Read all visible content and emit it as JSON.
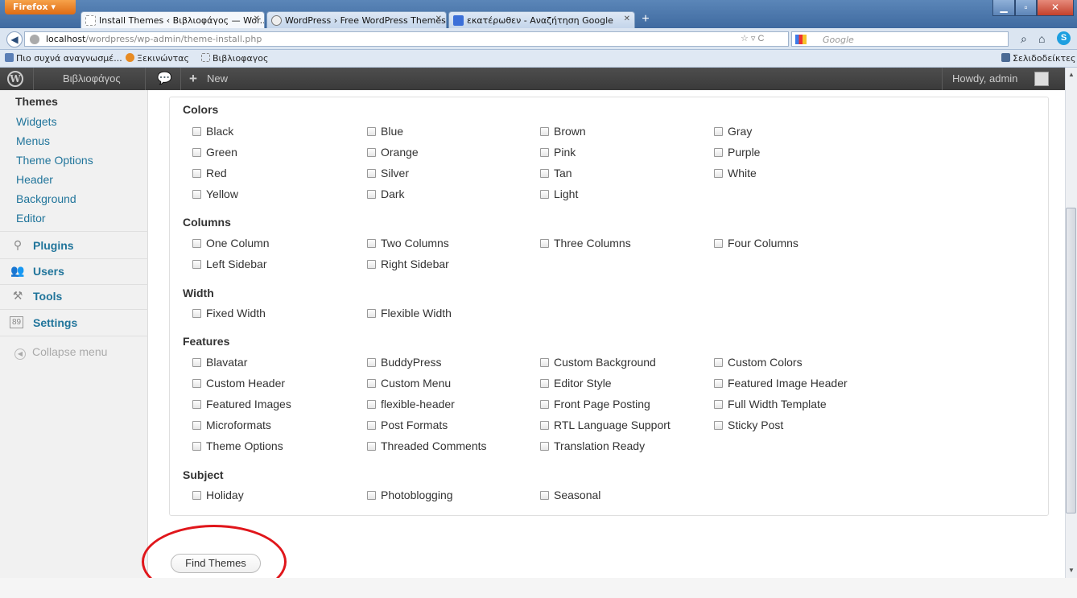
{
  "browser": {
    "menu_button": "Firefox ▾",
    "tabs": [
      {
        "title": "Install Themes ‹ Βιβλιοφάγος — Wor...",
        "icon": "page-icon",
        "active": true
      },
      {
        "title": "WordPress › Free WordPress Themes",
        "icon": "wordpress-icon",
        "active": false
      },
      {
        "title": "εκατέρωθεν - Αναζήτηση Google",
        "icon": "google-icon",
        "active": false
      }
    ],
    "url_host": "localhost",
    "url_path": "/wordpress/wp-admin/theme-install.php",
    "search_placeholder": "Google",
    "bookmarks": [
      "Πιο συχνά αναγνωσμέ...",
      "Ξεκινώντας",
      "Βιβλιοφαγος"
    ],
    "bookmarks_menu": "Σελιδοδείκτες"
  },
  "adminbar": {
    "site_name": "Βιβλιοφάγος",
    "new_label": "New",
    "greeting": "Howdy, admin"
  },
  "sidebar": {
    "appearance_submenu": [
      "Themes",
      "Widgets",
      "Menus",
      "Theme Options",
      "Header",
      "Background",
      "Editor"
    ],
    "menu": [
      {
        "label": "Plugins",
        "icon": "plugin-icon"
      },
      {
        "label": "Users",
        "icon": "users-icon"
      },
      {
        "label": "Tools",
        "icon": "tools-icon"
      },
      {
        "label": "Settings",
        "icon": "settings-icon"
      }
    ],
    "collapse": "Collapse menu"
  },
  "filters": {
    "colors": {
      "heading": "Colors",
      "options": [
        "Black",
        "Blue",
        "Brown",
        "Gray",
        "Green",
        "Orange",
        "Pink",
        "Purple",
        "Red",
        "Silver",
        "Tan",
        "White",
        "Yellow",
        "Dark",
        "Light"
      ]
    },
    "columns": {
      "heading": "Columns",
      "options": [
        "One Column",
        "Two Columns",
        "Three Columns",
        "Four Columns",
        "Left Sidebar",
        "Right Sidebar"
      ]
    },
    "width": {
      "heading": "Width",
      "options": [
        "Fixed Width",
        "Flexible Width"
      ]
    },
    "features": {
      "heading": "Features",
      "options": [
        "Blavatar",
        "BuddyPress",
        "Custom Background",
        "Custom Colors",
        "Custom Header",
        "Custom Menu",
        "Editor Style",
        "Featured Image Header",
        "Featured Images",
        "flexible-header",
        "Front Page Posting",
        "Full Width Template",
        "Microformats",
        "Post Formats",
        "RTL Language Support",
        "Sticky Post",
        "Theme Options",
        "Threaded Comments",
        "Translation Ready"
      ]
    },
    "subject": {
      "heading": "Subject",
      "options": [
        "Holiday",
        "Photoblogging",
        "Seasonal"
      ]
    }
  },
  "find_button": "Find Themes"
}
